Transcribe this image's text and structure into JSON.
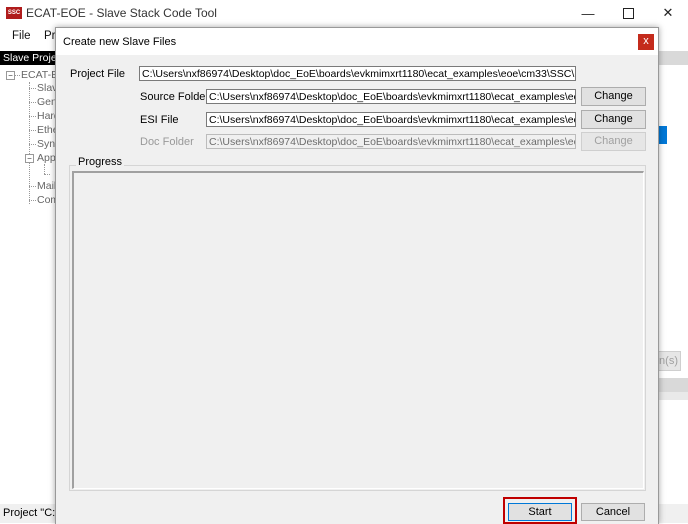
{
  "main_window": {
    "title": "ECAT-EOE - Slave Stack Code Tool",
    "icon_text": "SSC",
    "menu": [
      "File",
      "Pr"
    ],
    "sidebar_header": "Slave Project",
    "tree": [
      "ECAT-E",
      "Slav",
      "Gen",
      "Hard",
      "Ethe",
      "Sync",
      "Appl",
      "Mail",
      "Com"
    ],
    "right_button_partial": "n(s)",
    "status_text": "Project \"C:\\"
  },
  "dialog": {
    "title": "Create new Slave Files",
    "close_glyph": "x",
    "project_file": {
      "label": "Project File",
      "value": "C:\\Users\\nxf86974\\Desktop\\doc_EoE\\boards\\evkmimxrt1180\\ecat_examples\\eoe\\cm33\\SSC\\ECAT-"
    },
    "source_folder": {
      "label": "Source Folder",
      "value": "C:\\Users\\nxf86974\\Desktop\\doc_EoE\\boards\\evkmimxrt1180\\ecat_examples\\eoe\\cm",
      "button": "Change"
    },
    "esi_file": {
      "label": "ESI File",
      "value": "C:\\Users\\nxf86974\\Desktop\\doc_EoE\\boards\\evkmimxrt1180\\ecat_examples\\eoe\\cm",
      "button": "Change"
    },
    "doc_folder": {
      "label": "Doc Folder",
      "value": "C:\\Users\\nxf86974\\Desktop\\doc_EoE\\boards\\evkmimxrt1180\\ecat_examples\\eoe\\cm",
      "button": "Change"
    },
    "progress_label": "Progress",
    "start_button": "Start",
    "cancel_button": "Cancel"
  },
  "colors": {
    "close_red": "#c42b1c",
    "highlight_red": "#c00000",
    "default_button_blue": "#0078d7",
    "dialog_bg": "#f0f0f0"
  }
}
